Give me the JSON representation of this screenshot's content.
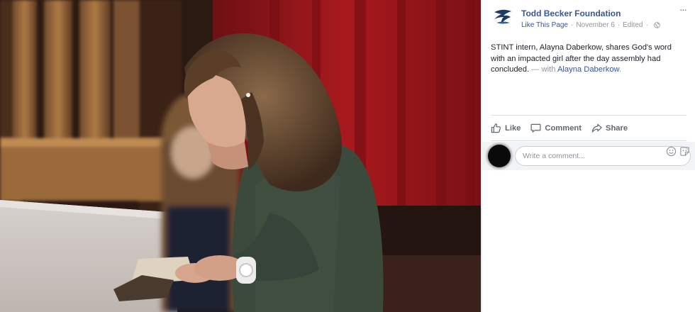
{
  "photo": {
    "description_icon": "photo-of-two-women-reading",
    "colors": {
      "curtain": "#a9191d",
      "stage": "#cfc9c6",
      "wood": "#a8733f",
      "sweater": "#3b4a3a"
    }
  },
  "post": {
    "page_name": "Todd Becker Foundation",
    "like_page": "Like This Page",
    "date": "November 6",
    "edited": "Edited",
    "privacy_icon": "globe-icon",
    "more_label": "···",
    "body": "STINT intern, Alayna Daberkow, shares God's word with an impacted girl after the day assembly had concluded.",
    "with_sep": "— with",
    "tagged": "Alayna Daberkow",
    "period": "."
  },
  "actions": [
    {
      "label": "Like",
      "icon": "thumbs-up-icon"
    },
    {
      "label": "Comment",
      "icon": "comment-icon"
    },
    {
      "label": "Share",
      "icon": "share-icon"
    }
  ],
  "comment": {
    "placeholder": "Write a comment...",
    "emoji_icon": "emoji-icon",
    "sticker_icon": "sticker-icon"
  },
  "colors": {
    "link": "#365899",
    "muted": "#90949c",
    "text": "#1d2129",
    "action": "#606770"
  }
}
